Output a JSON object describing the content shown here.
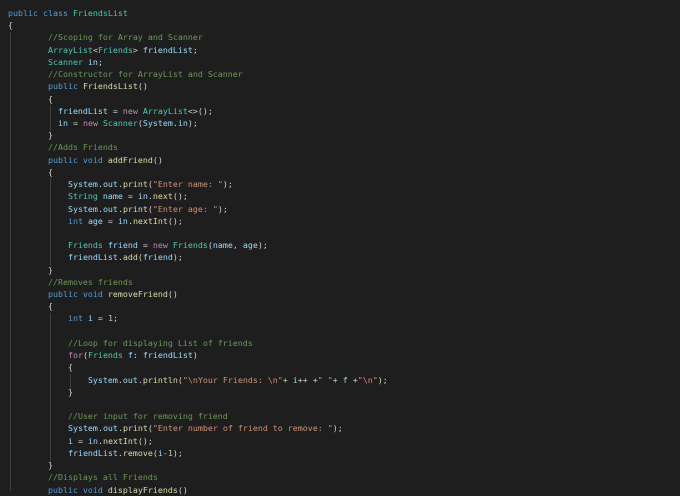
{
  "colors": {
    "background": "#1e1e1e",
    "keyword": "#569cd6",
    "type": "#4ec9b0",
    "comment": "#6a9955",
    "variable": "#9cdcfe",
    "function": "#dcdcaa",
    "string": "#ce9178",
    "control": "#c586c0",
    "number": "#b5cea8",
    "plain": "#d4d4d4"
  },
  "lines": [
    [
      [
        "public class ",
        "kw"
      ],
      [
        "FriendsList",
        "ty"
      ]
    ],
    [
      [
        "{",
        "pl"
      ]
    ],
    [
      [
        "        ",
        "pl"
      ],
      [
        "//Scoping for Array and Scanner",
        "cm"
      ]
    ],
    [
      [
        "        ",
        "pl"
      ],
      [
        "ArrayList",
        "ty"
      ],
      [
        "<",
        "pl"
      ],
      [
        "Friends",
        "ty"
      ],
      [
        "> ",
        "pl"
      ],
      [
        "friendList",
        "va"
      ],
      [
        ";",
        "pl"
      ]
    ],
    [
      [
        "        ",
        "pl"
      ],
      [
        "Scanner ",
        "ty"
      ],
      [
        "in",
        "va"
      ],
      [
        ";",
        "pl"
      ]
    ],
    [
      [
        "        ",
        "pl"
      ],
      [
        "//Constructor for ArrayList and Scanner",
        "cm"
      ]
    ],
    [
      [
        "        ",
        "pl"
      ],
      [
        "public ",
        "kw"
      ],
      [
        "FriendsList",
        "fn"
      ],
      [
        "()",
        "pl"
      ]
    ],
    [
      [
        "        {",
        "pl"
      ]
    ],
    [
      [
        "          ",
        "pl"
      ],
      [
        "friendList",
        "va"
      ],
      [
        " = ",
        "pl"
      ],
      [
        "new ",
        "ct"
      ],
      [
        "ArrayList",
        "ty"
      ],
      [
        "<>();",
        "pl"
      ]
    ],
    [
      [
        "          ",
        "pl"
      ],
      [
        "in",
        "va"
      ],
      [
        " = ",
        "pl"
      ],
      [
        "new ",
        "ct"
      ],
      [
        "Scanner",
        "ty"
      ],
      [
        "(",
        "pl"
      ],
      [
        "System",
        "va"
      ],
      [
        ".",
        "pl"
      ],
      [
        "in",
        "va"
      ],
      [
        ");",
        "pl"
      ]
    ],
    [
      [
        "        }",
        "pl"
      ]
    ],
    [
      [
        "        ",
        "pl"
      ],
      [
        "//Adds Friends",
        "cm"
      ]
    ],
    [
      [
        "        ",
        "pl"
      ],
      [
        "public void ",
        "kw"
      ],
      [
        "addFriend",
        "fn"
      ],
      [
        "()",
        "pl"
      ]
    ],
    [
      [
        "        {",
        "pl"
      ]
    ],
    [
      [
        "            ",
        "pl"
      ],
      [
        "System",
        "va"
      ],
      [
        ".",
        "pl"
      ],
      [
        "out",
        "va"
      ],
      [
        ".",
        "pl"
      ],
      [
        "print",
        "fn"
      ],
      [
        "(",
        "pl"
      ],
      [
        "\"Enter name: \"",
        "st"
      ],
      [
        ");",
        "pl"
      ]
    ],
    [
      [
        "            ",
        "pl"
      ],
      [
        "String ",
        "ty"
      ],
      [
        "name",
        "va"
      ],
      [
        " = ",
        "pl"
      ],
      [
        "in",
        "va"
      ],
      [
        ".",
        "pl"
      ],
      [
        "next",
        "fn"
      ],
      [
        "();",
        "pl"
      ]
    ],
    [
      [
        "            ",
        "pl"
      ],
      [
        "System",
        "va"
      ],
      [
        ".",
        "pl"
      ],
      [
        "out",
        "va"
      ],
      [
        ".",
        "pl"
      ],
      [
        "print",
        "fn"
      ],
      [
        "(",
        "pl"
      ],
      [
        "\"Enter age: \"",
        "st"
      ],
      [
        ");",
        "pl"
      ]
    ],
    [
      [
        "            ",
        "pl"
      ],
      [
        "int ",
        "kw"
      ],
      [
        "age",
        "va"
      ],
      [
        " = ",
        "pl"
      ],
      [
        "in",
        "va"
      ],
      [
        ".",
        "pl"
      ],
      [
        "nextInt",
        "fn"
      ],
      [
        "();",
        "pl"
      ]
    ],
    [],
    [
      [
        "            ",
        "pl"
      ],
      [
        "Friends ",
        "ty"
      ],
      [
        "friend",
        "va"
      ],
      [
        " = ",
        "pl"
      ],
      [
        "new ",
        "ct"
      ],
      [
        "Friends",
        "ty"
      ],
      [
        "(",
        "pl"
      ],
      [
        "name",
        "va"
      ],
      [
        ", ",
        "pl"
      ],
      [
        "age",
        "va"
      ],
      [
        ");",
        "pl"
      ]
    ],
    [
      [
        "            ",
        "pl"
      ],
      [
        "friendList",
        "va"
      ],
      [
        ".",
        "pl"
      ],
      [
        "add",
        "fn"
      ],
      [
        "(",
        "pl"
      ],
      [
        "friend",
        "va"
      ],
      [
        ");",
        "pl"
      ]
    ],
    [
      [
        "        }",
        "pl"
      ]
    ],
    [
      [
        "        ",
        "pl"
      ],
      [
        "//Removes friends",
        "cm"
      ]
    ],
    [
      [
        "        ",
        "pl"
      ],
      [
        "public void ",
        "kw"
      ],
      [
        "removeFriend",
        "fn"
      ],
      [
        "()",
        "pl"
      ]
    ],
    [
      [
        "        {",
        "pl"
      ]
    ],
    [
      [
        "            ",
        "pl"
      ],
      [
        "int ",
        "kw"
      ],
      [
        "i",
        "va"
      ],
      [
        " = ",
        "pl"
      ],
      [
        "1",
        "nu"
      ],
      [
        ";",
        "pl"
      ]
    ],
    [],
    [
      [
        "            ",
        "pl"
      ],
      [
        "//Loop for displaying List of friends",
        "cm"
      ]
    ],
    [
      [
        "            ",
        "pl"
      ],
      [
        "for",
        "ct"
      ],
      [
        "(",
        "pl"
      ],
      [
        "Friends ",
        "ty"
      ],
      [
        "f",
        "va"
      ],
      [
        ": ",
        "pl"
      ],
      [
        "friendList",
        "va"
      ],
      [
        ")",
        "pl"
      ]
    ],
    [
      [
        "            {",
        "pl"
      ]
    ],
    [
      [
        "                ",
        "pl"
      ],
      [
        "System",
        "va"
      ],
      [
        ".",
        "pl"
      ],
      [
        "out",
        "va"
      ],
      [
        ".",
        "pl"
      ],
      [
        "println",
        "fn"
      ],
      [
        "(",
        "pl"
      ],
      [
        "\"\\nYour Friends: \\n\"",
        "st"
      ],
      [
        "+ ",
        "pl"
      ],
      [
        "i",
        "va"
      ],
      [
        "++ +",
        "pl"
      ],
      [
        "\" \"",
        "st"
      ],
      [
        "+ ",
        "pl"
      ],
      [
        "f",
        "va"
      ],
      [
        " +",
        "pl"
      ],
      [
        "\"\\n\"",
        "st"
      ],
      [
        ");",
        "pl"
      ]
    ],
    [
      [
        "            }",
        "pl"
      ]
    ],
    [],
    [
      [
        "            ",
        "pl"
      ],
      [
        "//User input for removing friend",
        "cm"
      ]
    ],
    [
      [
        "            ",
        "pl"
      ],
      [
        "System",
        "va"
      ],
      [
        ".",
        "pl"
      ],
      [
        "out",
        "va"
      ],
      [
        ".",
        "pl"
      ],
      [
        "print",
        "fn"
      ],
      [
        "(",
        "pl"
      ],
      [
        "\"Enter number of friend to remove: \"",
        "st"
      ],
      [
        ");",
        "pl"
      ]
    ],
    [
      [
        "            ",
        "pl"
      ],
      [
        "i",
        "va"
      ],
      [
        " = ",
        "pl"
      ],
      [
        "in",
        "va"
      ],
      [
        ".",
        "pl"
      ],
      [
        "nextInt",
        "fn"
      ],
      [
        "();",
        "pl"
      ]
    ],
    [
      [
        "            ",
        "pl"
      ],
      [
        "friendList",
        "va"
      ],
      [
        ".",
        "pl"
      ],
      [
        "remove",
        "fn"
      ],
      [
        "(",
        "pl"
      ],
      [
        "i",
        "va"
      ],
      [
        "-",
        "pl"
      ],
      [
        "1",
        "nu"
      ],
      [
        ");",
        "pl"
      ]
    ],
    [
      [
        "        }",
        "pl"
      ]
    ],
    [
      [
        "        ",
        "pl"
      ],
      [
        "//Displays all Friends",
        "cm"
      ]
    ],
    [
      [
        "        ",
        "pl"
      ],
      [
        "public void ",
        "kw"
      ],
      [
        "displayFriends",
        "fn"
      ],
      [
        "()",
        "pl"
      ]
    ]
  ]
}
